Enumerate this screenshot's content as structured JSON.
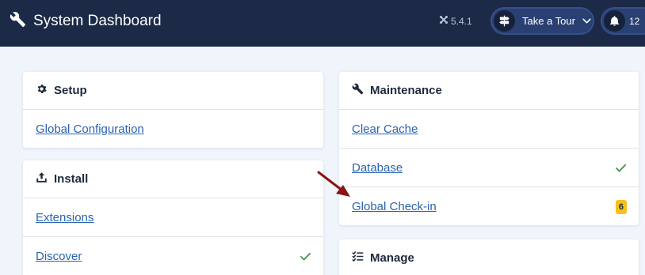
{
  "header": {
    "title": "System Dashboard",
    "version": "5.4.1",
    "tour_label": "Take a Tour",
    "notifications_count": "12"
  },
  "cards": {
    "setup": {
      "title": "Setup",
      "items": [
        "Global Configuration"
      ]
    },
    "install": {
      "title": "Install",
      "items": [
        "Extensions",
        "Discover"
      ]
    },
    "maintenance": {
      "title": "Maintenance",
      "items": [
        "Clear Cache",
        "Database",
        "Global Check-in"
      ],
      "checkin_badge": "6"
    },
    "manage": {
      "title": "Manage"
    }
  },
  "colors": {
    "topbar": "#1c2a47",
    "link": "#2a63b0",
    "check": "#3a8a3f",
    "badge": "#f7c01a",
    "annotation_arrow": "#8a1414"
  },
  "icons": [
    "wrench-icon",
    "joomla-icon",
    "signpost-icon",
    "chevron-down-icon",
    "bell-icon",
    "gear-icon",
    "upload-icon",
    "list-check-icon",
    "check-icon"
  ]
}
